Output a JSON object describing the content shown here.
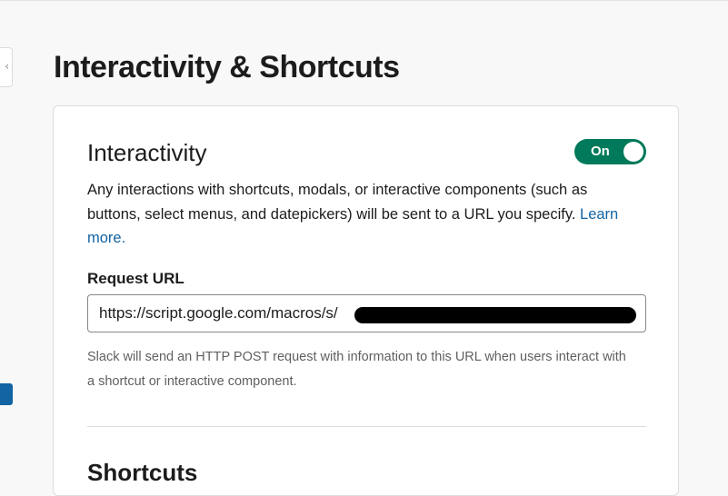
{
  "page": {
    "title": "Interactivity & Shortcuts"
  },
  "interactivity": {
    "title": "Interactivity",
    "toggle": {
      "label": "On",
      "state": true,
      "color": "#007a5a"
    },
    "description": "Any interactions with shortcuts, modals, or interactive components (such as buttons, select menus, and datepickers) will be sent to a URL you specify.",
    "learn_more": "Learn more.",
    "request_url": {
      "label": "Request URL",
      "value": "https://script.google.com/macros/s/",
      "redacted": true
    },
    "help_text": "Slack will send an HTTP POST request with information to this URL when users interact with a shortcut or interactive component."
  },
  "shortcuts": {
    "title": "Shortcuts"
  },
  "colors": {
    "link": "#1264a3",
    "accent": "#1264a3"
  }
}
